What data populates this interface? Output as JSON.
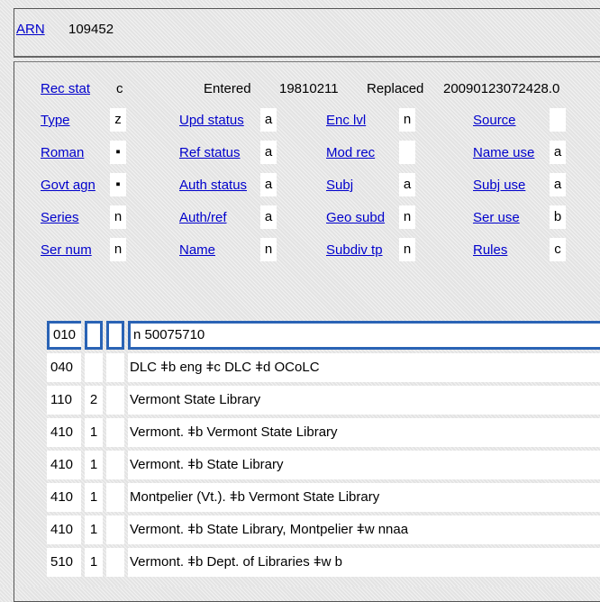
{
  "arn": {
    "label": "ARN",
    "value": "109452"
  },
  "header": {
    "rec_stat": {
      "label": "Rec stat",
      "value": "c"
    },
    "entered": {
      "label": "Entered",
      "value": "19810211"
    },
    "replaced": {
      "label": "Replaced",
      "value": "20090123072428.0"
    }
  },
  "fixed_fields": [
    {
      "label": "Type",
      "value": "z"
    },
    {
      "label": "Upd status",
      "value": "a"
    },
    {
      "label": "Enc lvl",
      "value": "n"
    },
    {
      "label": "Source",
      "value": ""
    },
    {
      "label": "Roman",
      "value": "▪"
    },
    {
      "label": "Ref status",
      "value": "a"
    },
    {
      "label": "Mod rec",
      "value": ""
    },
    {
      "label": "Name use",
      "value": "a"
    },
    {
      "label": "Govt agn",
      "value": "▪"
    },
    {
      "label": "Auth status",
      "value": "a"
    },
    {
      "label": "Subj",
      "value": "a"
    },
    {
      "label": "Subj use",
      "value": "a"
    },
    {
      "label": "Series",
      "value": "n"
    },
    {
      "label": "Auth/ref",
      "value": "a"
    },
    {
      "label": "Geo subd",
      "value": "n"
    },
    {
      "label": "Ser use",
      "value": "b"
    },
    {
      "label": "Ser num",
      "value": "n"
    },
    {
      "label": "Name",
      "value": "n"
    },
    {
      "label": "Subdiv tp",
      "value": "n"
    },
    {
      "label": "Rules",
      "value": "c"
    }
  ],
  "variable_fields": [
    {
      "tag": "010",
      "ind1": "",
      "ind2": "",
      "value": "n  50075710",
      "selected": true
    },
    {
      "tag": "040",
      "ind1": "",
      "ind2": "",
      "value": "DLC ǂb eng ǂc DLC ǂd OCoLC"
    },
    {
      "tag": "110",
      "ind1": "2",
      "ind2": "",
      "value": "Vermont State Library"
    },
    {
      "tag": "410",
      "ind1": "1",
      "ind2": "",
      "value": "Vermont. ǂb Vermont State Library"
    },
    {
      "tag": "410",
      "ind1": "1",
      "ind2": "",
      "value": "Vermont. ǂb State Library"
    },
    {
      "tag": "410",
      "ind1": "1",
      "ind2": "",
      "value": "Montpelier (Vt.). ǂb Vermont State Library"
    },
    {
      "tag": "410",
      "ind1": "1",
      "ind2": "",
      "value": "Vermont. ǂb State Library, Montpelier ǂw nnaa"
    },
    {
      "tag": "510",
      "ind1": "1",
      "ind2": "",
      "value": "Vermont. ǂb Dept. of Libraries ǂw b"
    }
  ]
}
